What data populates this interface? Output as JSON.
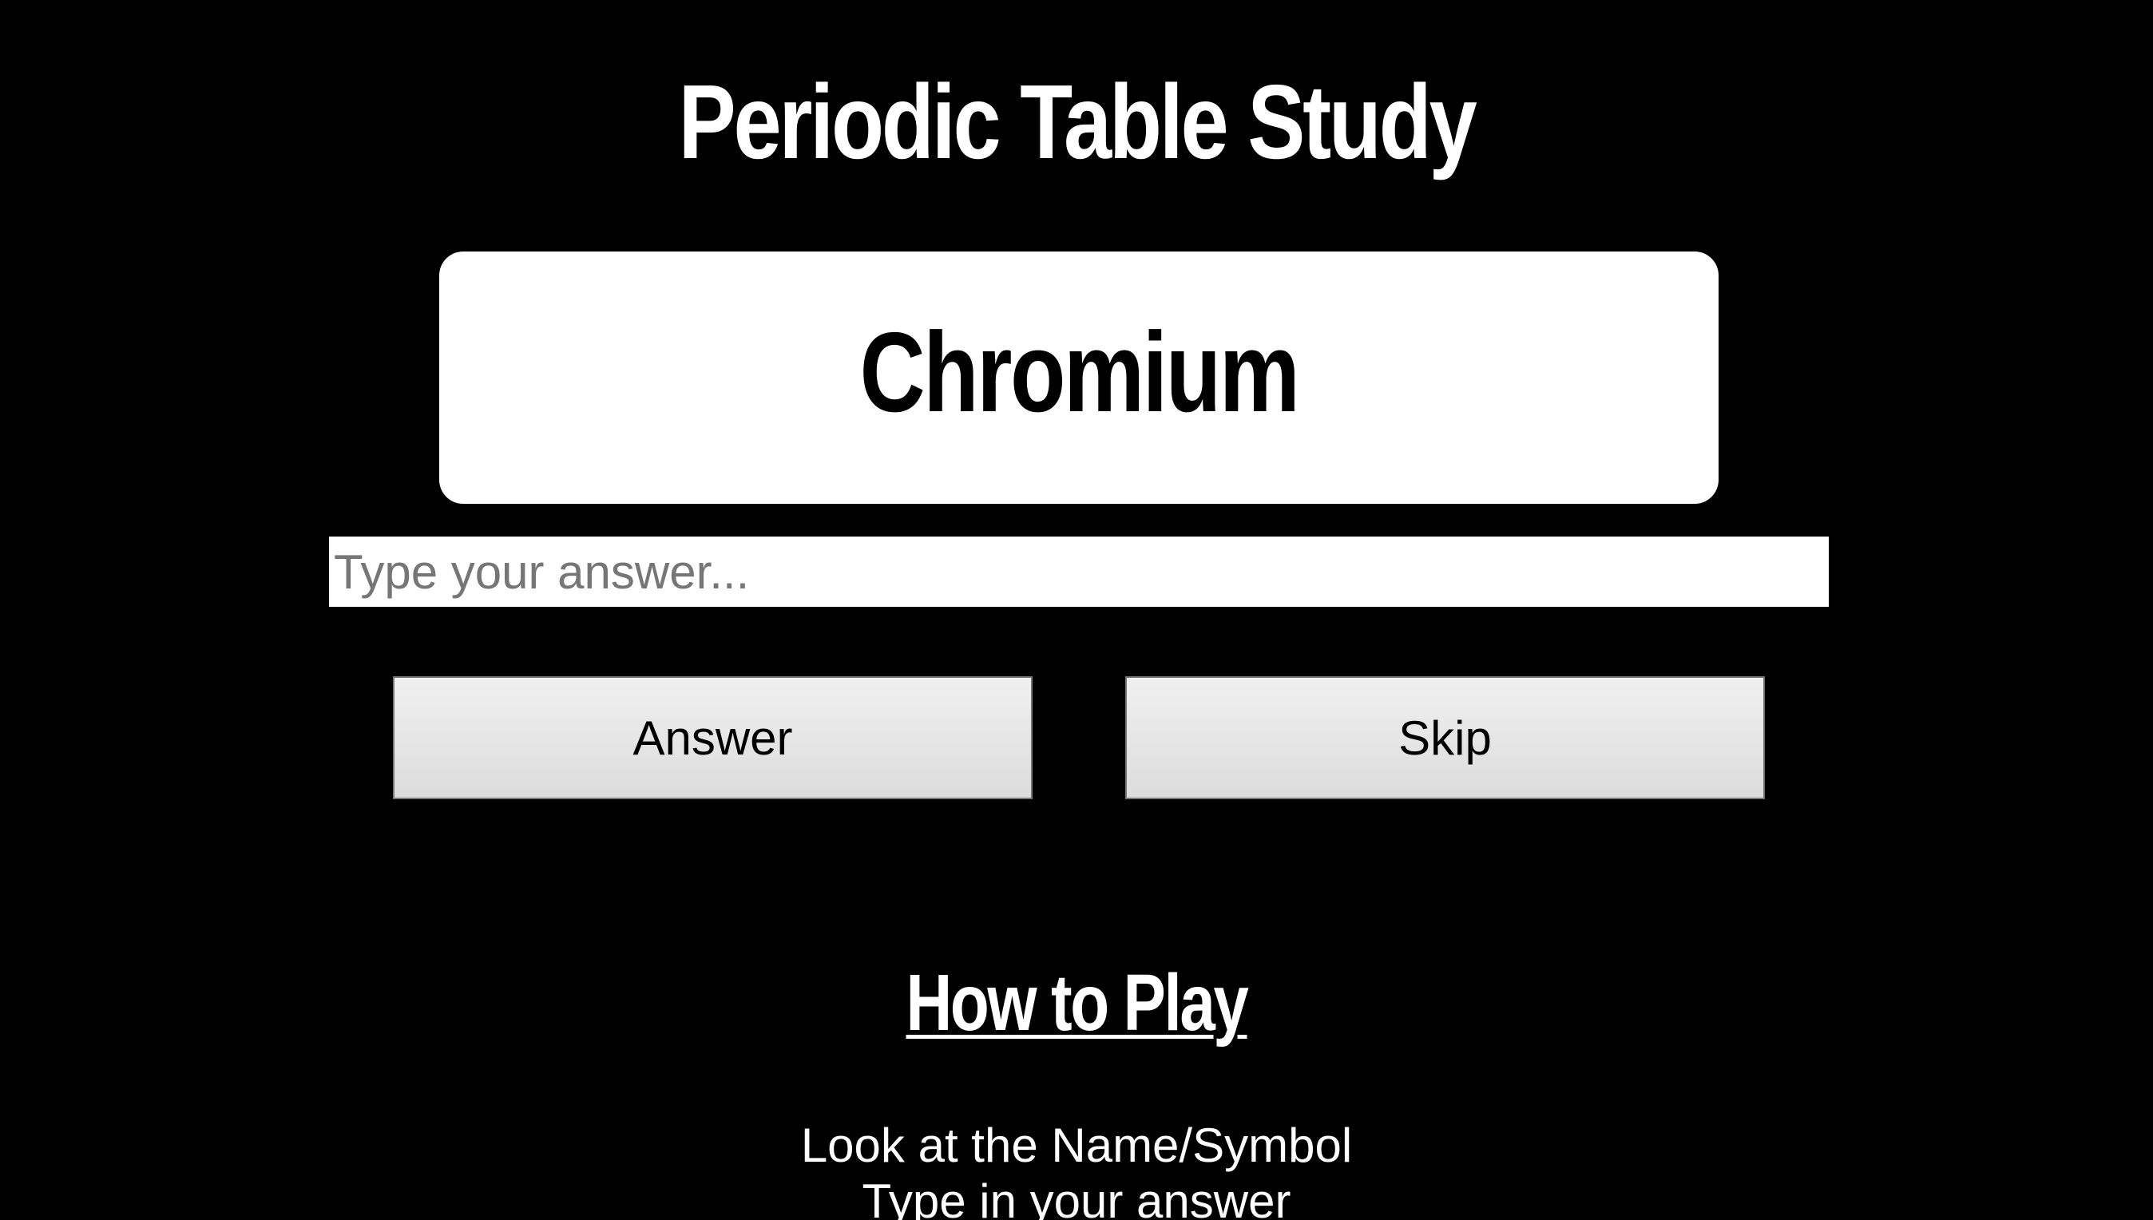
{
  "header": {
    "title": "Periodic Table Study"
  },
  "card": {
    "prompt": "Chromium"
  },
  "answer": {
    "value": "",
    "placeholder": "Type your answer..."
  },
  "buttons": {
    "answer_label": "Answer",
    "skip_label": "Skip"
  },
  "how_to_play": {
    "title": "How to Play",
    "lines": [
      "Look at the Name/Symbol",
      "Type in your answer"
    ]
  },
  "colors": {
    "background": "#000000",
    "foreground": "#ffffff",
    "card": "#ffffff",
    "placeholder": "#767676"
  }
}
